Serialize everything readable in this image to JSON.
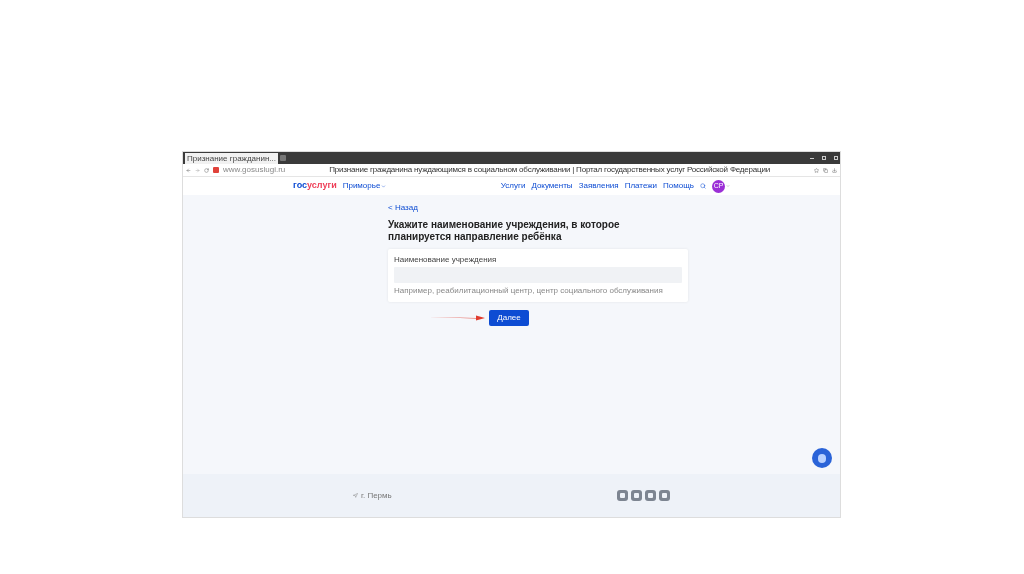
{
  "browser": {
    "tab_title": "Признание гражданин...",
    "url": "www.gosuslugi.ru",
    "page_title": "Признание гражданина нуждающимся в социальном обслуживании | Портал государственных услуг Российской Федерации"
  },
  "header": {
    "logo_part1": "гос",
    "logo_part2": "услуги",
    "location": "Приморье",
    "nav": [
      "Услуги",
      "Документы",
      "Заявления",
      "Платежи",
      "Помощь"
    ],
    "avatar": "СР"
  },
  "form": {
    "back": "< Назад",
    "heading": "Укажите наименование учреждения, в которое планируется направление ребёнка",
    "field_label": "Наименование учреждения",
    "field_hint": "Например, реабилитационный центр, центр социального обслуживания",
    "button": "Далее"
  },
  "footer": {
    "location": "г. Пермь"
  }
}
